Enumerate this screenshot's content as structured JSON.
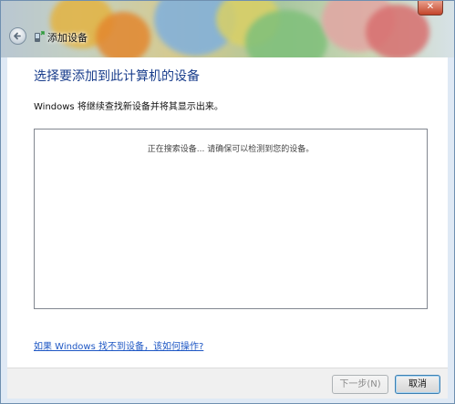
{
  "window": {
    "title": "添加设备",
    "close_glyph": "✕"
  },
  "content": {
    "heading": "选择要添加到此计算机的设备",
    "description": "Windows 将继续查找新设备并将其显示出来。",
    "device_list": {
      "status": "正在搜索设备... 请确保可以检测到您的设备。"
    },
    "help_link": "如果 Windows 找不到设备，该如何操作?"
  },
  "footer": {
    "next_label": "下一步(N)",
    "cancel_label": "取消"
  },
  "icons": {
    "back": "back-arrow-icon",
    "wizard": "device-wizard-icon",
    "close": "close-icon"
  },
  "colors": {
    "heading": "#1a3e8c",
    "link": "#1e57c4"
  }
}
